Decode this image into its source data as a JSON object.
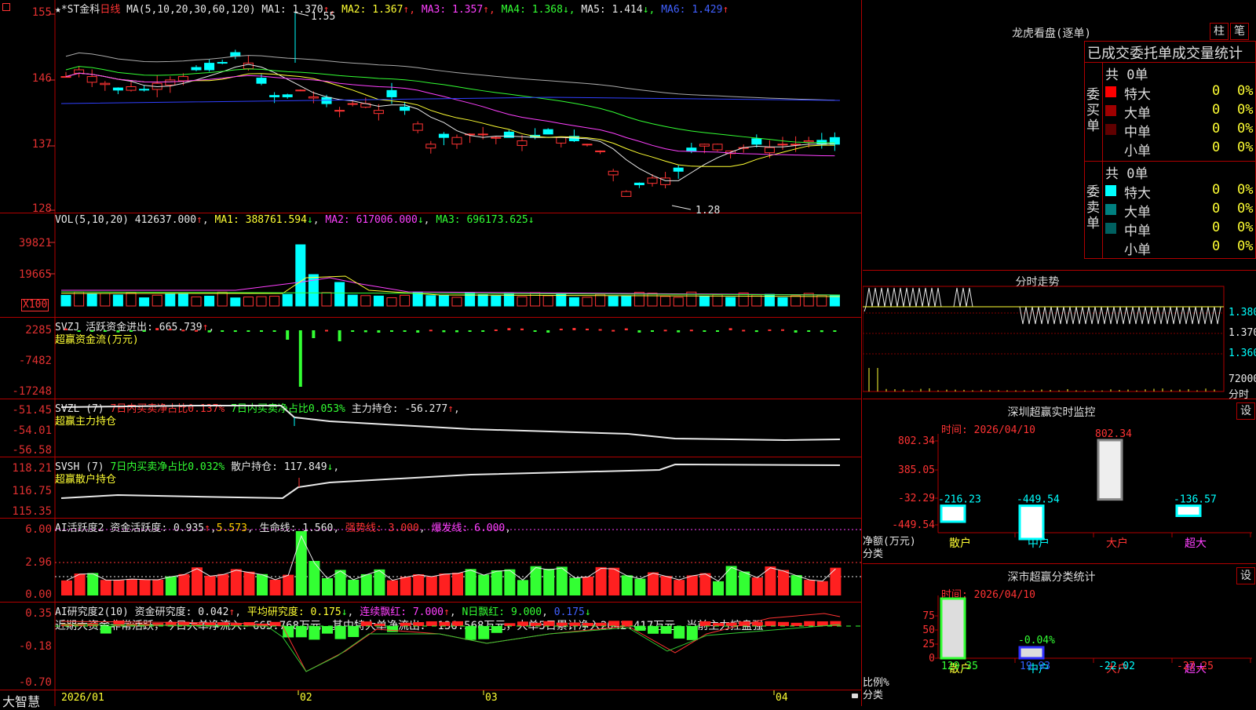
{
  "main": {
    "title_stars": "★*ST金科",
    "period": "日线",
    "ma_label": "MA(5,10,20,30,60,120)",
    "ma": [
      {
        "name": "MA1",
        "value": "1.370",
        "arrow": "↑",
        "color": "#e8e8e8"
      },
      {
        "name": "MA2",
        "value": "1.367",
        "arrow": "↑",
        "color": "#ffff33"
      },
      {
        "name": "MA3",
        "value": "1.357",
        "arrow": "↑",
        "color": "#ff40ff"
      },
      {
        "name": "MA4",
        "value": "1.368",
        "arrow": "↓",
        "color": "#33ff33"
      },
      {
        "name": "MA5",
        "value": "1.414",
        "arrow": "↓",
        "color": "#e8e8e8"
      },
      {
        "name": "MA6",
        "value": "1.429",
        "arrow": "↑",
        "color": "#4060ff"
      }
    ],
    "y_ticks": [
      "155",
      "146",
      "137",
      "128"
    ],
    "high_label": "1.55",
    "low_label": "1.28"
  },
  "vol": {
    "label": "VOL(5,10,20)",
    "value": "412637.000",
    "ma1": "388761.594",
    "ma2": "617006.000",
    "ma3": "696173.625",
    "y_ticks": [
      "39821",
      "19665"
    ],
    "unit": "X100"
  },
  "svzj": {
    "label": "SVZJ",
    "text": "活跃资金进出: 665.739",
    "sub": "超赢资金流(万元)",
    "y_ticks": [
      "2285",
      "-7482",
      "-17248"
    ]
  },
  "svzl": {
    "label": "SVZL (7)",
    "t1": "7日内买卖净占比0.137%",
    "t2": "7日内买卖净占比0.053%",
    "t3": "主力持仓: -56.277",
    "sub": "超赢主力持仓",
    "y_ticks": [
      "-51.45",
      "-54.01",
      "-56.58"
    ]
  },
  "svsh": {
    "label": "SVSH (7)",
    "t1": "7日内买卖净占比0.032%",
    "t2": "散户持仓: 117.849",
    "sub": "超赢散户持仓",
    "y_ticks": [
      "118.21",
      "116.75",
      "115.35"
    ]
  },
  "ai1": {
    "label": "AI活跃度2",
    "t1": "资金活跃度: 0.935",
    "t2": "5.573",
    "t3": "生命线: 1.560",
    "t4": "强势线: 3.000",
    "t5": "爆发线: 6.000",
    "y_ticks": [
      "6.00",
      "2.96",
      "0.00"
    ]
  },
  "ai2": {
    "label": "AI研究度2(10)",
    "t1": "资金研究度: 0.042",
    "t2": "平均研究度: 0.175",
    "t3": "连续飘红: 7.000",
    "t4": "N日飘红: 9.000",
    "t5": "0.175",
    "comment": "近期大资金非常活跃，今日大单净流入：665.768万元，其中特大单净流出：-136.568万元，大单5日累计净入2042.417万元，当前主力控盘强",
    "y_ticks": [
      "0.35",
      "-0.18",
      "-0.70"
    ]
  },
  "axis": {
    "app_name": "大智慧",
    "dates": [
      "2026/01",
      "02",
      "03",
      "04"
    ]
  },
  "lhb": {
    "title": "龙虎看盘(逐单)",
    "btn1": "柱",
    "btn2": "笔",
    "subtitle": "已成交委托单成交量统计",
    "buy": {
      "side": "委买单",
      "total": "共 0单",
      "rows": [
        {
          "name": "特大",
          "v1": "0",
          "v2": "0%",
          "color": "#ff0000"
        },
        {
          "name": "大单",
          "v1": "0",
          "v2": "0%",
          "color": "#a00000"
        },
        {
          "name": "中单",
          "v1": "0",
          "v2": "0%",
          "color": "#600000"
        },
        {
          "name": "小单",
          "v1": "0",
          "v2": "0%",
          "color": "#000000"
        }
      ]
    },
    "sell": {
      "side": "委卖单",
      "total": "共 0单",
      "rows": [
        {
          "name": "特大",
          "v1": "0",
          "v2": "0%",
          "color": "#00ffff"
        },
        {
          "name": "大单",
          "v1": "0",
          "v2": "0%",
          "color": "#008080"
        },
        {
          "name": "中单",
          "v1": "0",
          "v2": "0%",
          "color": "#006060"
        },
        {
          "name": "小单",
          "v1": "0",
          "v2": "0%",
          "color": "#000000"
        }
      ]
    }
  },
  "fenshi": {
    "title": "分时走势",
    "y_labels": [
      "1.380",
      "1.370",
      "1.360"
    ],
    "vol_label": "72000",
    "unit": "分时"
  },
  "monitor": {
    "title": "深圳超赢实时监控",
    "btn": "设",
    "time": "时间: 2026/04/10",
    "y_ticks": [
      "802.34",
      "385.05",
      "-32.29",
      "-449.54"
    ],
    "ylabel": "净额(万元)",
    "xlabel": "分类",
    "categories": [
      "散户",
      "中户",
      "大户",
      "超大"
    ],
    "values": [
      "-216.23",
      "-449.54",
      "802.34",
      "-136.57"
    ]
  },
  "classify": {
    "title": "深市超赢分类统计",
    "btn": "设",
    "time": "时间: 2026/04/10",
    "y_ticks": [
      "75",
      "50",
      "25",
      "0"
    ],
    "ylabel": "比例%",
    "xlabel": "分类",
    "categories": [
      "散户",
      "中户",
      "大户",
      "超大"
    ],
    "values": [
      "129.35",
      "19.93",
      "-22.02",
      "-27.25"
    ],
    "mid_label": "-0.04%"
  },
  "chart_data": [
    {
      "type": "bar",
      "title": "深圳超赢实时监控",
      "categories": [
        "散户",
        "中户",
        "大户",
        "超大"
      ],
      "values": [
        -216.23,
        -449.54,
        802.34,
        -136.57
      ],
      "ylabel": "净额(万元)",
      "xlabel": "分类",
      "ylim": [
        -449.54,
        802.34
      ]
    },
    {
      "type": "bar",
      "title": "深市超赢分类统计",
      "categories": [
        "散户",
        "中户",
        "大户",
        "超大"
      ],
      "values": [
        129.35,
        19.93,
        -22.02,
        -27.25
      ],
      "ylabel": "比例%",
      "xlabel": "分类",
      "ylim": [
        0,
        75
      ]
    }
  ]
}
